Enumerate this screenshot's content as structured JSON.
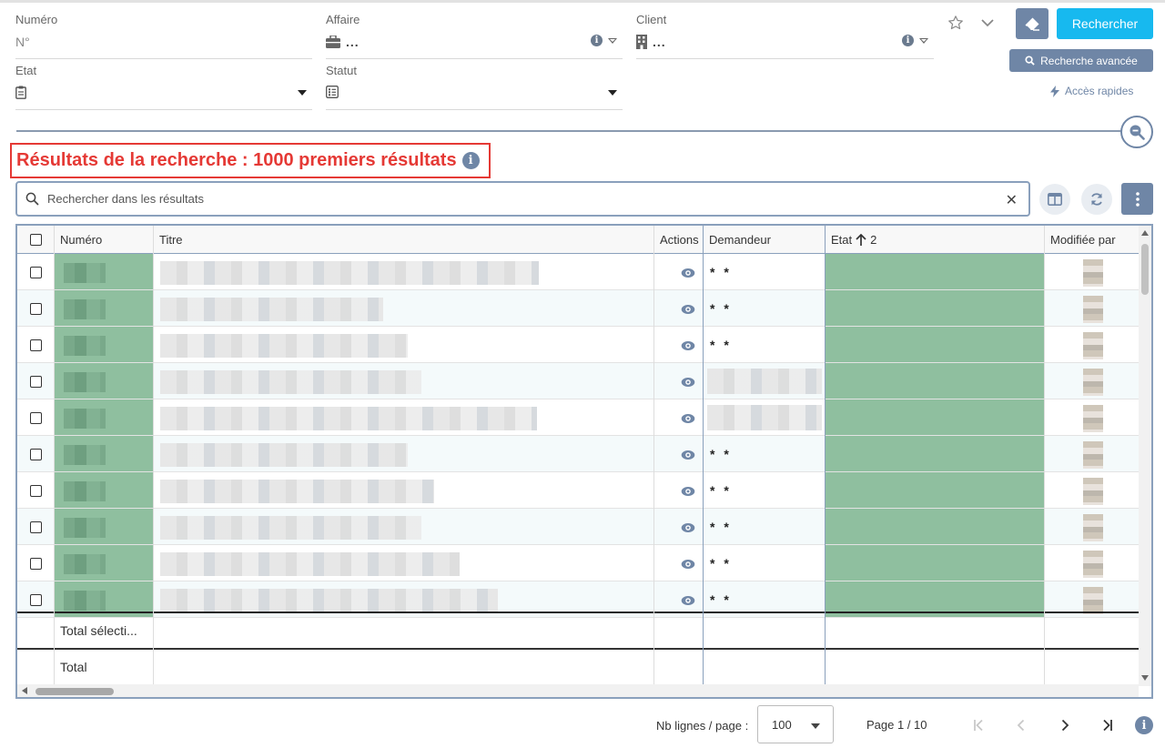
{
  "filters": {
    "numero": {
      "label": "Numéro",
      "placeholder": "N°"
    },
    "affaire": {
      "label": "Affaire",
      "value": "..."
    },
    "client": {
      "label": "Client",
      "value": "..."
    },
    "etat": {
      "label": "Etat",
      "value": ""
    },
    "statut": {
      "label": "Statut",
      "value": ""
    }
  },
  "actions": {
    "search_label": "Rechercher",
    "advanced_label": "Recherche avancée",
    "quick_access_label": "Accès rapides",
    "info_glyph": "i"
  },
  "results": {
    "title": "Résultats de la recherche : 1000 premiers résultats",
    "search_placeholder": "Rechercher dans les résultats",
    "clear_glyph": "✕"
  },
  "table": {
    "columns": {
      "numero": "Numéro",
      "titre": "Titre",
      "actions": "Actions",
      "demandeur": "Demandeur",
      "etat": "Etat",
      "etat_sort_rank": "2",
      "modifiee_par": "Modifiée par"
    },
    "rows": [
      {
        "demandeur": "* *"
      },
      {
        "demandeur": "* *"
      },
      {
        "demandeur": "* *"
      },
      {
        "demandeur": ""
      },
      {
        "demandeur": ""
      },
      {
        "demandeur": "* *"
      },
      {
        "demandeur": "* *"
      },
      {
        "demandeur": "* *"
      },
      {
        "demandeur": "* *"
      },
      {
        "demandeur": "* *"
      }
    ],
    "total_selection_label": "Total sélecti...",
    "total_label": "Total"
  },
  "pagination": {
    "rows_per_page_label": "Nb lignes / page :",
    "rows_per_page_value": "100",
    "page_info": "Page 1 / 10"
  },
  "colors": {
    "accent": "#17b9ef",
    "slate": "#6f86a6",
    "highlight_red": "#e53935",
    "status_green": "#8fbf9f"
  },
  "icons": [
    "briefcase-icon",
    "building-icon",
    "clipboard-icon",
    "list-icon",
    "star-icon",
    "chevron-down-icon",
    "eraser-icon",
    "search-icon",
    "bolt-icon",
    "zoom-out-icon",
    "info-icon",
    "columns-icon",
    "refresh-icon",
    "kebab-icon",
    "eye-icon",
    "arrow-up-icon",
    "first-page-icon",
    "prev-page-icon",
    "next-page-icon",
    "last-page-icon"
  ]
}
